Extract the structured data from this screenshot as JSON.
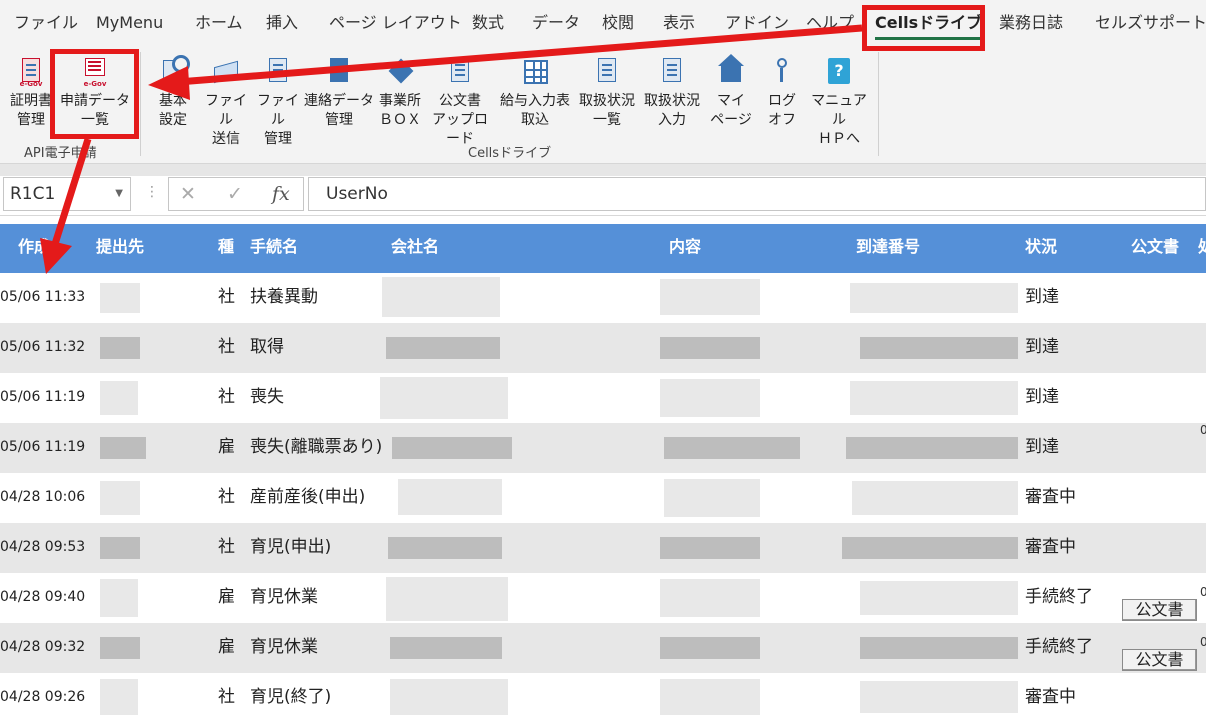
{
  "menu": {
    "tabs": [
      "ファイル",
      "MyMenu",
      "ホーム",
      "挿入",
      "ページ レイアウト",
      "数式",
      "データ",
      "校閲",
      "表示",
      "アドイン",
      "ヘルプ",
      "Cellsドライブ",
      "業務日誌",
      "セルズサポート"
    ],
    "active_tab": "Cellsドライブ"
  },
  "ribbon": {
    "groups": [
      {
        "label": "API電子申請",
        "buttons": [
          {
            "label1": "証明書",
            "label2": "管理",
            "icon": "egov-certificate-icon"
          },
          {
            "label1": "申請データ",
            "label2": "一覧",
            "icon": "egov-list-icon"
          }
        ]
      },
      {
        "label": "Cellsドライブ",
        "buttons": [
          {
            "label1": "基本",
            "label2": "設定",
            "icon": "settings-icon"
          },
          {
            "label1": "ファイル",
            "label2": "送信",
            "icon": "send-file-icon"
          },
          {
            "label1": "ファイル",
            "label2": "管理",
            "icon": "file-manage-icon"
          },
          {
            "label1": "連絡データ",
            "label2": "管理",
            "icon": "contact-data-icon"
          },
          {
            "label1": "事業所",
            "label2": "ＢＯＸ",
            "icon": "box-icon"
          },
          {
            "label1": "公文書",
            "label2": "アップロード",
            "icon": "upload-doc-icon"
          },
          {
            "label1": "給与入力表",
            "label2": "取込",
            "icon": "salary-import-icon"
          },
          {
            "label1": "取扱状況",
            "label2": "一覧",
            "icon": "status-list-icon"
          },
          {
            "label1": "取扱状況",
            "label2": "入力",
            "icon": "status-input-icon"
          },
          {
            "label1": "マイ",
            "label2": "ページ",
            "icon": "home-icon"
          },
          {
            "label1": "ログ",
            "label2": "オフ",
            "icon": "key-icon"
          },
          {
            "label1": "マニュアル",
            "label2": "ＨＰへ",
            "icon": "help-icon"
          }
        ]
      }
    ]
  },
  "formula_bar": {
    "name_box": "R1C1",
    "cancel": "✕",
    "enter": "✓",
    "fx": "fx",
    "value": "UserNo"
  },
  "table": {
    "headers": {
      "date": "作成",
      "dest": "提出先",
      "kind": "種",
      "proc": "手続名",
      "company": "会社名",
      "content": "内容",
      "arrival": "到達番号",
      "status": "状況",
      "doc": "公文書",
      "edge": "処"
    },
    "rows": [
      {
        "date": "05/06 11:33",
        "kind": "社",
        "proc": "扶養異動",
        "status": "到達",
        "doc_button": "",
        "edge": ""
      },
      {
        "date": "05/06 11:32",
        "kind": "社",
        "proc": "取得",
        "status": "到達",
        "doc_button": "",
        "edge": ""
      },
      {
        "date": "05/06 11:19",
        "kind": "社",
        "proc": "喪失",
        "status": "到達",
        "doc_button": "",
        "edge": ""
      },
      {
        "date": "05/06 11:19",
        "kind": "雇",
        "proc": "喪失(離職票あり)",
        "status": "到達",
        "doc_button": "",
        "edge": "0"
      },
      {
        "date": "04/28 10:06",
        "kind": "社",
        "proc": "産前産後(申出)",
        "status": "審査中",
        "doc_button": "",
        "edge": ""
      },
      {
        "date": "04/28 09:53",
        "kind": "社",
        "proc": "育児(申出)",
        "status": "審査中",
        "doc_button": "",
        "edge": ""
      },
      {
        "date": "04/28 09:40",
        "kind": "雇",
        "proc": "育児休業",
        "status": "手続終了",
        "doc_button": "公文書",
        "edge": "0"
      },
      {
        "date": "04/28 09:32",
        "kind": "雇",
        "proc": "育児休業",
        "status": "手続終了",
        "doc_button": "公文書",
        "edge": "0"
      },
      {
        "date": "04/28 09:26",
        "kind": "社",
        "proc": "育児(終了)",
        "status": "審査中",
        "doc_button": "",
        "edge": ""
      }
    ]
  },
  "colors": {
    "header_bg": "#5590d8",
    "highlight": "#e41a1a",
    "active_tab_underline": "#217346"
  }
}
